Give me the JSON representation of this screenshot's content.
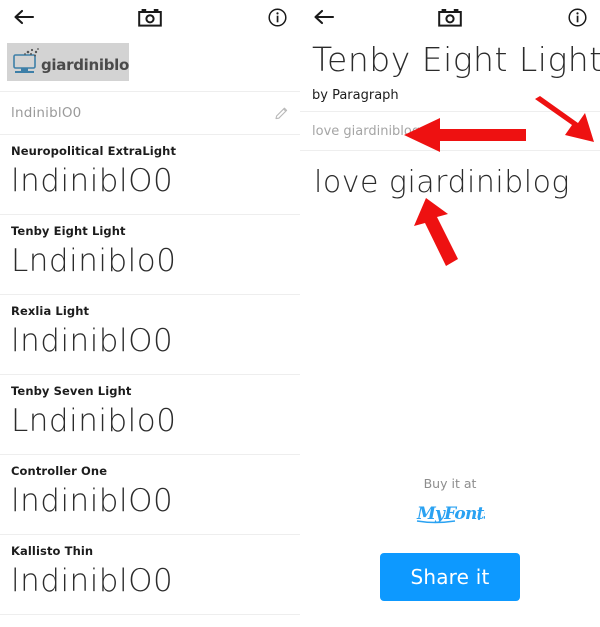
{
  "app": {
    "accent_blue": "#0d99ff",
    "divider_color": "#eeeeee",
    "annotation_color": "#ee1111"
  },
  "left_panel": {
    "topbar": {
      "back_icon": "back-arrow-icon",
      "camera_icon": "camera-icon",
      "info_icon": "info-icon"
    },
    "logo": {
      "alt": "giardiniblog",
      "text": "giardiniblog"
    },
    "search": {
      "value": "lndiniblO0",
      "edit_icon": "pencil-icon"
    },
    "fonts": [
      {
        "name": "Neuropolitical ExtraLight",
        "sample": "lndiniblO0"
      },
      {
        "name": "Tenby Eight Light",
        "sample": "Lndiniblo0"
      },
      {
        "name": "Rexlia Light",
        "sample": "lndiniblO0"
      },
      {
        "name": "Tenby Seven Light",
        "sample": "Lndiniblo0"
      },
      {
        "name": "Controller One",
        "sample": "lndiniblO0"
      },
      {
        "name": "Kallisto Thin",
        "sample": "lndiniblO0"
      }
    ]
  },
  "right_panel": {
    "topbar": {
      "back_icon": "back-arrow-icon",
      "camera_icon": "camera-icon",
      "info_icon": "info-icon"
    },
    "title": "Tenby Eight Light",
    "author": "by Paragraph",
    "input": {
      "value": "love giardiniblog",
      "edit_icon": "pencil-icon"
    },
    "preview_text": "love giardiniblog",
    "buy": {
      "label": "Buy it at",
      "vendor": "MyFonts"
    },
    "share_button": "Share it"
  },
  "annotations": [
    {
      "name": "arrow-to-input-text",
      "direction": "left"
    },
    {
      "name": "arrow-to-edit-pencil",
      "direction": "down-right"
    },
    {
      "name": "arrow-to-preview-text",
      "direction": "up"
    }
  ]
}
